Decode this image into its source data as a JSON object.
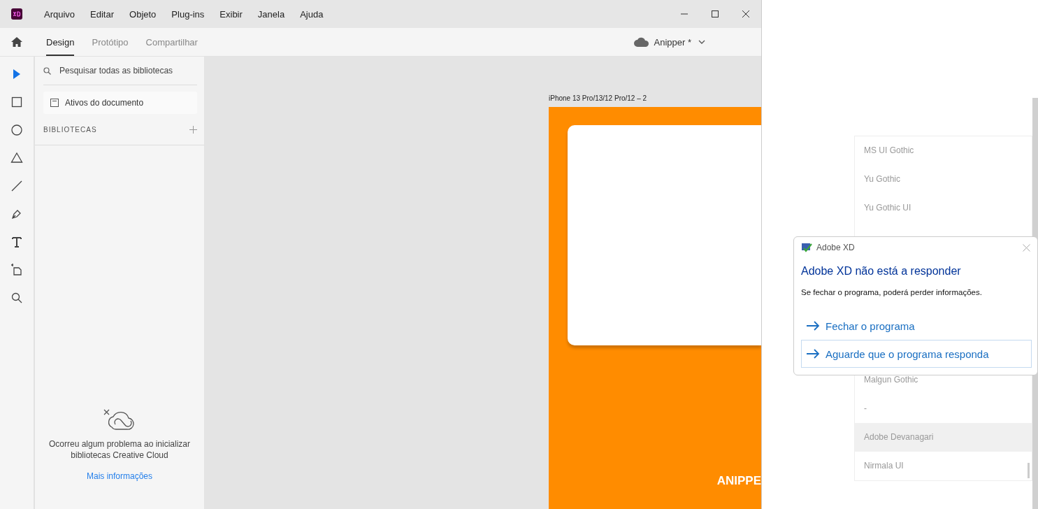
{
  "menu_bar": {
    "items": [
      "Arquivo",
      "Editar",
      "Objeto",
      "Plug-ins",
      "Exibir",
      "Janela",
      "Ajuda"
    ]
  },
  "mode_tabs": [
    {
      "label": "Design",
      "selected": true
    },
    {
      "label": "Protótipo",
      "selected": false
    },
    {
      "label": "Compartilhar",
      "selected": false
    }
  ],
  "document": {
    "name": "Anipper *"
  },
  "tools": [
    {
      "kind": "select",
      "selected": true
    },
    {
      "kind": "rectangle",
      "selected": false
    },
    {
      "kind": "ellipse",
      "selected": false
    },
    {
      "kind": "triangle",
      "selected": false
    },
    {
      "kind": "line",
      "selected": false
    },
    {
      "kind": "pen",
      "selected": false
    },
    {
      "kind": "text",
      "selected": false
    },
    {
      "kind": "artboard",
      "selected": false
    },
    {
      "kind": "zoom",
      "selected": false
    }
  ],
  "libraries_panel": {
    "search": {
      "placeholder": "Pesquisar todas as bibliotecas"
    },
    "document_assets": "Ativos do documento",
    "section_title": "BIBLIOTECAS",
    "error_message": "Ocorreu algum problema ao inicializar bibliotecas Creative Cloud",
    "more_info_link": "Mais informações"
  },
  "artboard": {
    "title": "iPhone 13 Pro/13/12 Pro/12 – 2",
    "footer_text": "ANIPPE"
  },
  "font_list": {
    "items_above": [
      {
        "name": "MS UI Gothic"
      },
      {
        "name": "Yu Gothic"
      },
      {
        "name": "Yu Gothic UI"
      }
    ],
    "items_below": [
      {
        "name": "Malgun Gothic",
        "hovered": false
      },
      {
        "name": "-",
        "hovered": false
      },
      {
        "name": "Adobe Devanagari",
        "hovered": true
      },
      {
        "name": "Nirmala UI",
        "hovered": false
      }
    ]
  },
  "dialog": {
    "title": "Adobe XD",
    "heading": "Adobe XD não está a responder",
    "message": "Se fechar o programa, poderá perder informações.",
    "options": [
      {
        "label": "Fechar o programa",
        "selected": false
      },
      {
        "label": "Aguarde que o programa responda",
        "selected": true
      }
    ]
  }
}
